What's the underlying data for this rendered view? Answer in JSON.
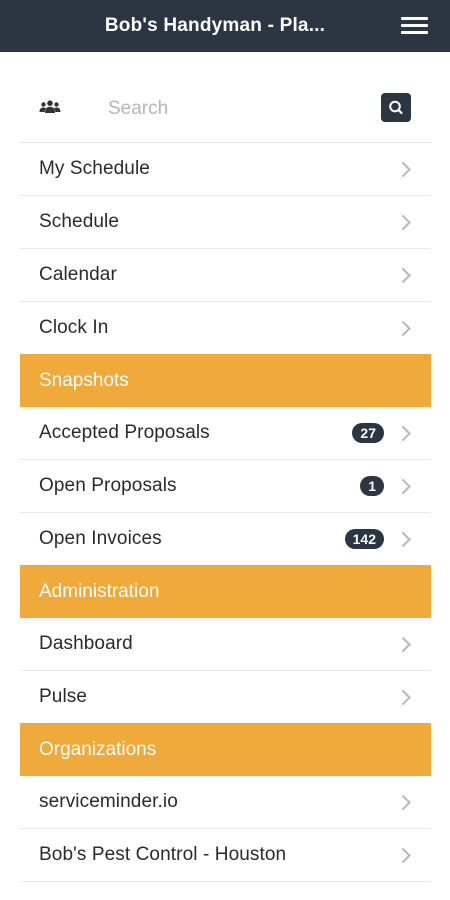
{
  "header": {
    "title": "Bob's Handyman - Pla...",
    "menu_icon": "hamburger-icon"
  },
  "search": {
    "placeholder": "Search",
    "left_icon": "users-icon",
    "button_icon": "search-icon"
  },
  "menu": {
    "items": [
      {
        "label": "My Schedule"
      },
      {
        "label": "Schedule"
      },
      {
        "label": "Calendar"
      },
      {
        "label": "Clock In"
      }
    ]
  },
  "snapshots": {
    "title": "Snapshots",
    "items": [
      {
        "label": "Accepted Proposals",
        "count": "27"
      },
      {
        "label": "Open Proposals",
        "count": "1"
      },
      {
        "label": "Open Invoices",
        "count": "142"
      }
    ]
  },
  "administration": {
    "title": "Administration",
    "items": [
      {
        "label": "Dashboard"
      },
      {
        "label": "Pulse"
      }
    ]
  },
  "organizations": {
    "title": "Organizations",
    "items": [
      {
        "label": "serviceminder.io"
      },
      {
        "label": "Bob's Pest Control - Houston"
      }
    ]
  },
  "colors": {
    "header_bg": "#2c3542",
    "section_bg": "#f0a93b",
    "badge_bg": "#2c3542"
  }
}
